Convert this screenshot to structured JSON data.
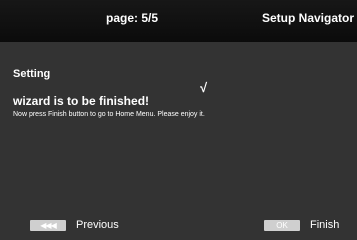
{
  "header": {
    "page_indicator": "page:  5/5",
    "title": "Setup Navigator"
  },
  "content": {
    "section_title": "Setting",
    "checkmark": "√",
    "headline": "wizard is to be finished!",
    "description": "Now press Finish button to go to Home Menu. Please enjoy it."
  },
  "footer": {
    "previous": {
      "key_icon": "skip-back-icon",
      "key_glyph": "◀◀◀",
      "label": "Previous"
    },
    "finish": {
      "key_label": "OK",
      "label": "Finish"
    }
  },
  "colors": {
    "background": "#333333",
    "header": "#111111",
    "key_button": "#cfcfcf",
    "text": "#ffffff"
  }
}
